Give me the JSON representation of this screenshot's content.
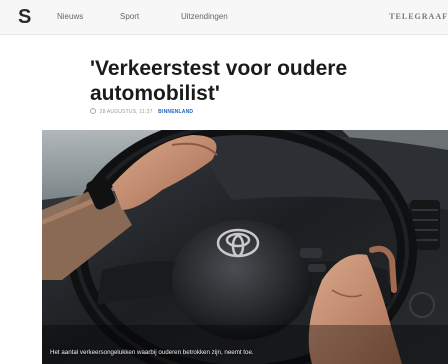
{
  "header": {
    "logo": "S",
    "nav": [
      "Nieuws",
      "Sport",
      "Uitzendingen"
    ],
    "brand": "TELEGRAAF"
  },
  "article": {
    "title": "'Verkeerstest voor oudere automobilist'",
    "date": "28 AUGUSTUS, 11:37",
    "category": "BINNENLAND",
    "caption": "Het aantal verkeersongelukken waarbij ouderen betrokken zijn, neemt toe."
  },
  "photo": {
    "description_icon": "steering-wheel-photo"
  }
}
